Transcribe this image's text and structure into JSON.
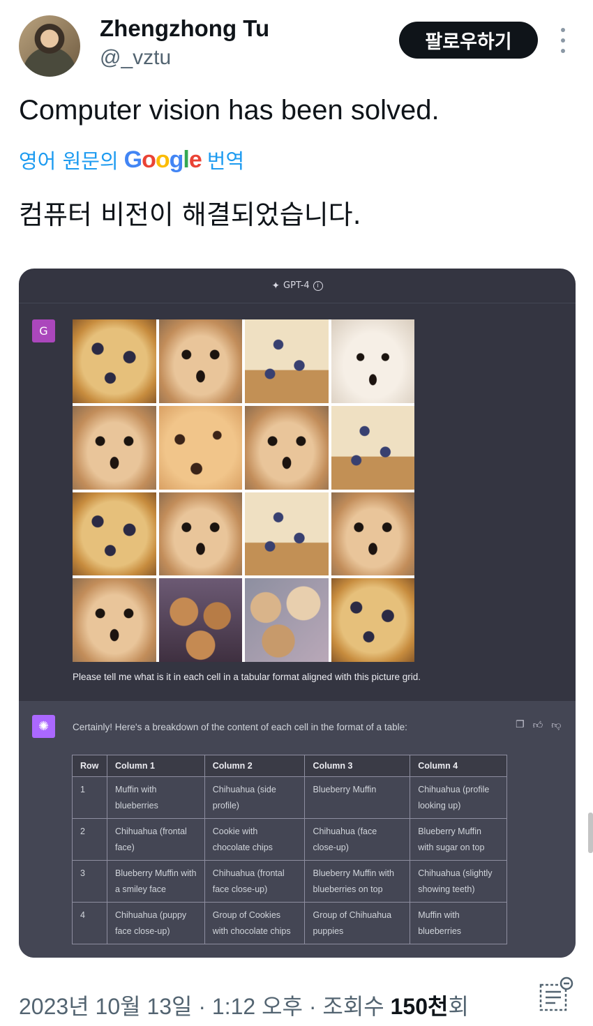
{
  "author": {
    "name": "Zhengzhong Tu",
    "handle": "@_vztu",
    "follow_label": "팔로우하기"
  },
  "tweet": {
    "text": "Computer vision has been solved.",
    "translate_prefix": "영어 원문의",
    "translate_brand": "Google",
    "translate_suffix": "번역",
    "translated_text": "컴퓨터 비전이 해결되었습니다."
  },
  "embed": {
    "model_label": "GPT-4",
    "user_initial": "G",
    "grid": [
      [
        "muffin",
        "dog",
        "muffin2",
        "dogw"
      ],
      [
        "dog",
        "cookie",
        "dog",
        "muffin2"
      ],
      [
        "muffin",
        "dog",
        "muffin2",
        "dog"
      ],
      [
        "dog",
        "cookies",
        "pups",
        "muffin"
      ]
    ],
    "prompt": "Please tell me what is it in each cell in a tabular format aligned with this picture grid.",
    "reply": "Certainly! Here's a breakdown of the content of each cell in the format of a table:",
    "table": {
      "headers": [
        "Row",
        "Column 1",
        "Column 2",
        "Column 3",
        "Column 4"
      ],
      "rows": [
        [
          "1",
          "Muffin with blueberries",
          "Chihuahua (side profile)",
          "Blueberry Muffin",
          "Chihuahua (profile looking up)"
        ],
        [
          "2",
          "Chihuahua (frontal face)",
          "Cookie with chocolate chips",
          "Chihuahua (face close-up)",
          "Blueberry Muffin with sugar on top"
        ],
        [
          "3",
          "Blueberry Muffin with a smiley face",
          "Chihuahua (frontal face close-up)",
          "Blueberry Muffin with blueberries on top",
          "Chihuahua (slightly showing teeth)"
        ],
        [
          "4",
          "Chihuahua (puppy face close-up)",
          "Group of Cookies with chocolate chips",
          "Group of Chihuahua puppies",
          "Muffin with blueberries"
        ]
      ]
    }
  },
  "footer": {
    "date": "2023년 10월 13일 · 1:12 오후 · 조회수 ",
    "views": "150천",
    "views_suffix": "회"
  },
  "colors": {
    "follow_bg": "#0f1419",
    "link": "#1d9bf0",
    "embed_bg": "#343541",
    "assistant_bg": "#444654",
    "user_avatar": "#ab47bc",
    "gpt_avatar": "#ab68ff"
  }
}
